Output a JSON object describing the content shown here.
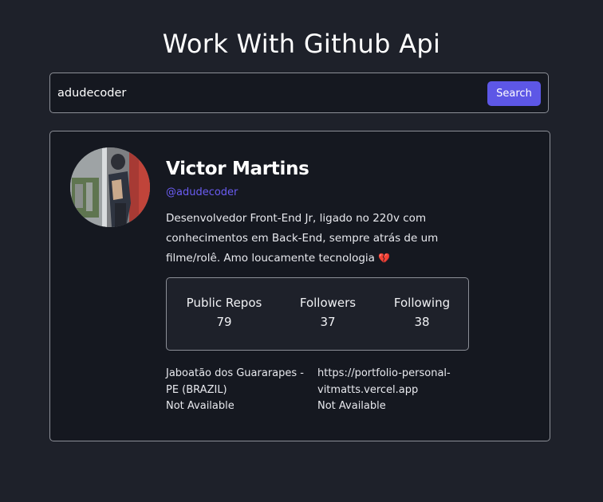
{
  "header": {
    "title": "Work With Github Api"
  },
  "search": {
    "value": "adudecoder",
    "button_label": "Search"
  },
  "profile": {
    "name": "Victor Martins",
    "login": "@adudecoder",
    "bio": "Desenvolvedor Front-End Jr, ligado no 220v com conhecimentos em Back-End, sempre atrás de um filme/rolê. Amo loucamente tecnologia",
    "bio_emoji": "💔",
    "stats": [
      {
        "label": "Public Repos",
        "value": "79"
      },
      {
        "label": "Followers",
        "value": "37"
      },
      {
        "label": "Following",
        "value": "38"
      }
    ],
    "location": "Jaboatão dos Guararapes - PE (BRAZIL)",
    "blog": "https://portfolio-personal-vitmatts.vercel.app",
    "twitter": "Not Available",
    "company": "Not Available"
  },
  "colors": {
    "background": "#1e212a",
    "card": "#151820",
    "accent": "#5d57e6",
    "link": "#6a5cf2",
    "border": "#8c8f97"
  },
  "icons": {
    "bio_emoji": "broken-heart-icon"
  }
}
